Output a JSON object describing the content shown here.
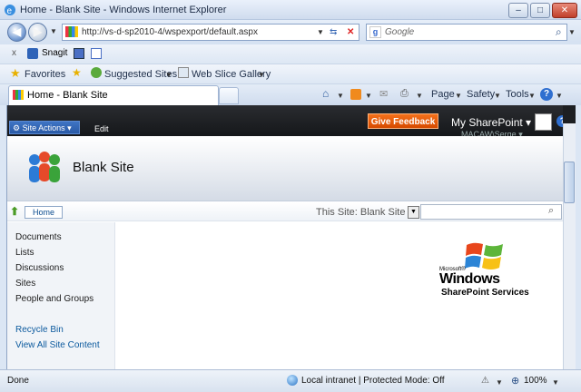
{
  "window": {
    "title": "Home - Blank Site - Windows Internet Explorer",
    "minimize": "–",
    "maximize": "□",
    "close": "✕"
  },
  "address": {
    "back": "◀",
    "forward": "▶",
    "url": "http://vs-d-sp2010-4/wspexport/default.aspx",
    "search_placeholder": "Google"
  },
  "snagit": {
    "close": "x",
    "label": "Snagit"
  },
  "favorites": {
    "favorites_label": "Favorites",
    "suggested_sites": "Suggested Sites",
    "web_slice_gallery": "Web Slice Gallery"
  },
  "tabs": {
    "active_tab": "Home - Blank Site"
  },
  "command_bar": {
    "page": "Page",
    "safety": "Safety",
    "tools": "Tools"
  },
  "sharepoint": {
    "site_actions": "Site Actions",
    "edit": "Edit",
    "give_feedback": "Give Feedback",
    "my_sharepoint": "My SharePoint",
    "user": "MACAW\\Serge",
    "site_title": "Blank Site",
    "home": "Home",
    "search_scope": "This Site: Blank Site",
    "quick_launch": [
      "Documents",
      "Lists",
      "Discussions",
      "Sites",
      "People and Groups"
    ],
    "recycle_bin": "Recycle Bin",
    "view_all": "View All Site Content",
    "logo_microsoft": "Microsoft®",
    "logo_windows": "Windows",
    "logo_sps": "SharePoint Services"
  },
  "status": {
    "done": "Done",
    "zone": "Local intranet | Protected Mode: Off",
    "zoom": "100%"
  },
  "colors": {
    "feedback": "#e65c0b",
    "ribbon": "#1d1f22",
    "link_blue": "#0c5a9e"
  }
}
